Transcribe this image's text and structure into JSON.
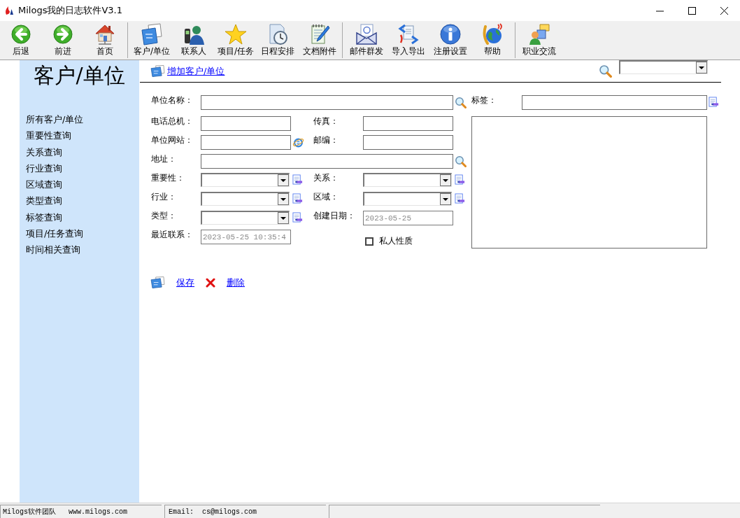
{
  "window": {
    "title": "Milogs我的日志软件V3.1"
  },
  "toolbar": {
    "groups": [
      {
        "buttons": [
          {
            "label": "后退"
          },
          {
            "label": "前进"
          },
          {
            "label": "首页"
          }
        ]
      },
      {
        "buttons": [
          {
            "label": "客户/单位"
          },
          {
            "label": "联系人"
          },
          {
            "label": "项目/任务"
          },
          {
            "label": "日程安排"
          },
          {
            "label": "文档附件"
          }
        ]
      },
      {
        "buttons": [
          {
            "label": "邮件群发"
          },
          {
            "label": "导入导出"
          },
          {
            "label": "注册设置"
          },
          {
            "label": "帮助"
          }
        ]
      },
      {
        "buttons": [
          {
            "label": "职业交流"
          }
        ]
      }
    ]
  },
  "sidebar": {
    "title": "客户/单位",
    "items": [
      {
        "label": "所有客户/单位"
      },
      {
        "label": "重要性查询"
      },
      {
        "label": "关系查询"
      },
      {
        "label": "行业查询"
      },
      {
        "label": "区域查询"
      },
      {
        "label": "类型查询"
      },
      {
        "label": "标签查询"
      },
      {
        "label": "项目/任务查询"
      },
      {
        "label": "时间相关查询"
      }
    ]
  },
  "header": {
    "add_link": "增加客户/单位"
  },
  "form": {
    "name": {
      "label": "单位名称："
    },
    "tags": {
      "label": "标签："
    },
    "phone": {
      "label": "电话总机："
    },
    "fax": {
      "label": "传真："
    },
    "website": {
      "label": "单位网站："
    },
    "postcode": {
      "label": "邮编："
    },
    "address": {
      "label": "地址："
    },
    "importance": {
      "label": "重要性："
    },
    "relation": {
      "label": "关系："
    },
    "industry": {
      "label": "行业："
    },
    "region": {
      "label": "区域："
    },
    "type": {
      "label": "类型："
    },
    "created": {
      "label": "创建日期：",
      "value": "2023-05-25",
      "disabled": true
    },
    "last_contact": {
      "label": "最近联系：",
      "value": "2023-05-25 10:35:4",
      "disabled": true
    },
    "private": {
      "label": "私人性质",
      "checked": false
    }
  },
  "actions": [
    {
      "label": "保存"
    },
    {
      "label": "删除"
    }
  ],
  "status_bar": {
    "team": "Milogs软件团队",
    "website": "www.milogs.com",
    "email": "Email:  cs@milogs.com"
  }
}
